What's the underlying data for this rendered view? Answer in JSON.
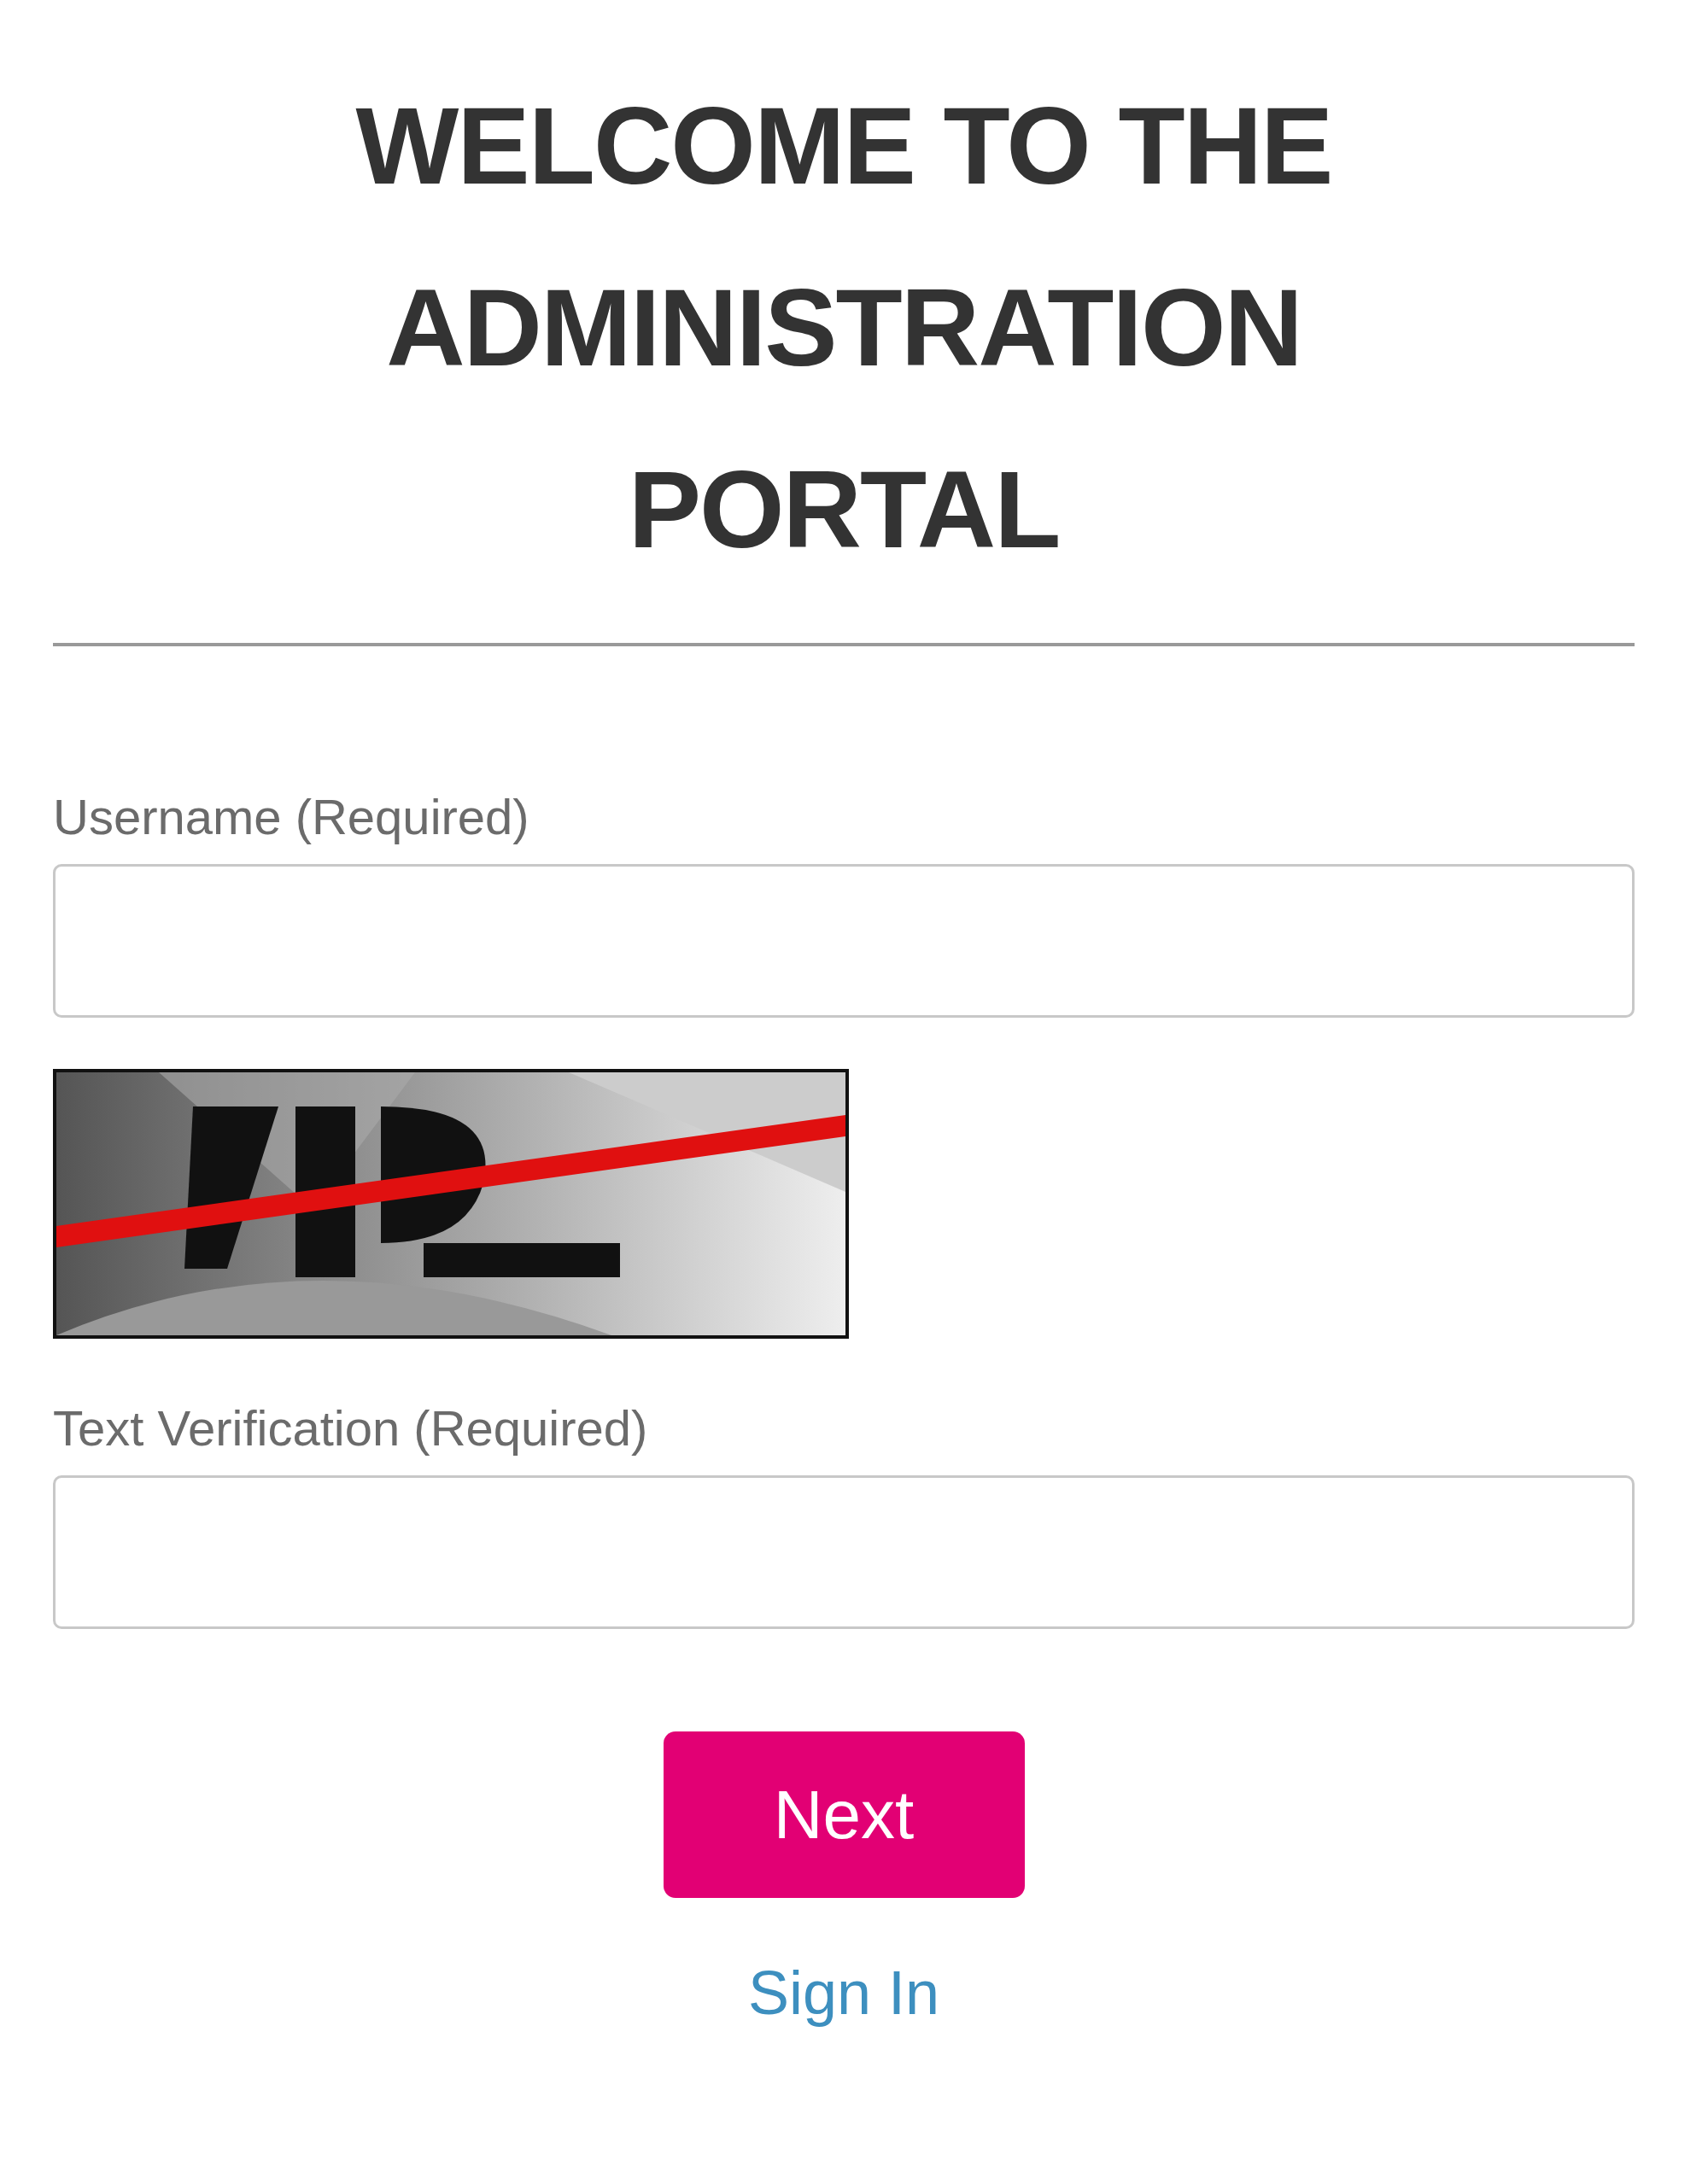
{
  "title": "WELCOME TO THE ADMINISTRATION PORTAL",
  "fields": [
    {
      "label": "Username (Required)",
      "kind": "text"
    },
    {
      "kind": "picture"
    },
    {
      "label": "Text Verification (Required)",
      "kind": "text"
    }
  ],
  "button": "Next",
  "link": "Sign In"
}
